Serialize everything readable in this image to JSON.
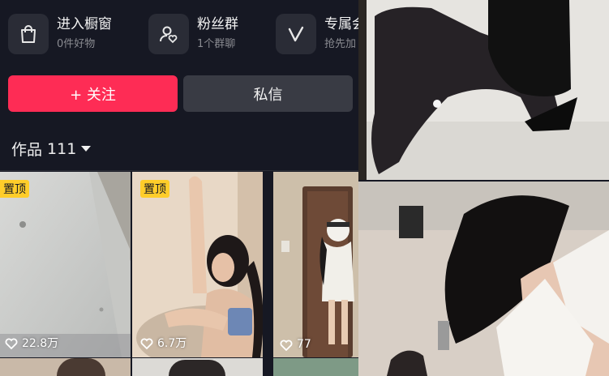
{
  "shortcuts": [
    {
      "title": "进入橱窗",
      "subtitle": "0件好物",
      "icon": "shopping-bag-icon"
    },
    {
      "title": "粉丝群",
      "subtitle": "1个群聊",
      "icon": "fan-group-icon"
    },
    {
      "title": "专属会",
      "subtitle": "抢先加",
      "icon": "v-badge-icon"
    }
  ],
  "actions": {
    "follow": "+ 关注",
    "message": "私信"
  },
  "works": {
    "label": "作品",
    "count": "111"
  },
  "grid": [
    {
      "pinned": "置顶",
      "likes": "22.8万"
    },
    {
      "pinned": "置顶",
      "likes": "6.7万"
    },
    {
      "pinned": "",
      "likes": "77"
    }
  ],
  "colors": {
    "background": "#161823",
    "follow": "#fe2c55",
    "pin_badge": "#ffcd2a"
  }
}
